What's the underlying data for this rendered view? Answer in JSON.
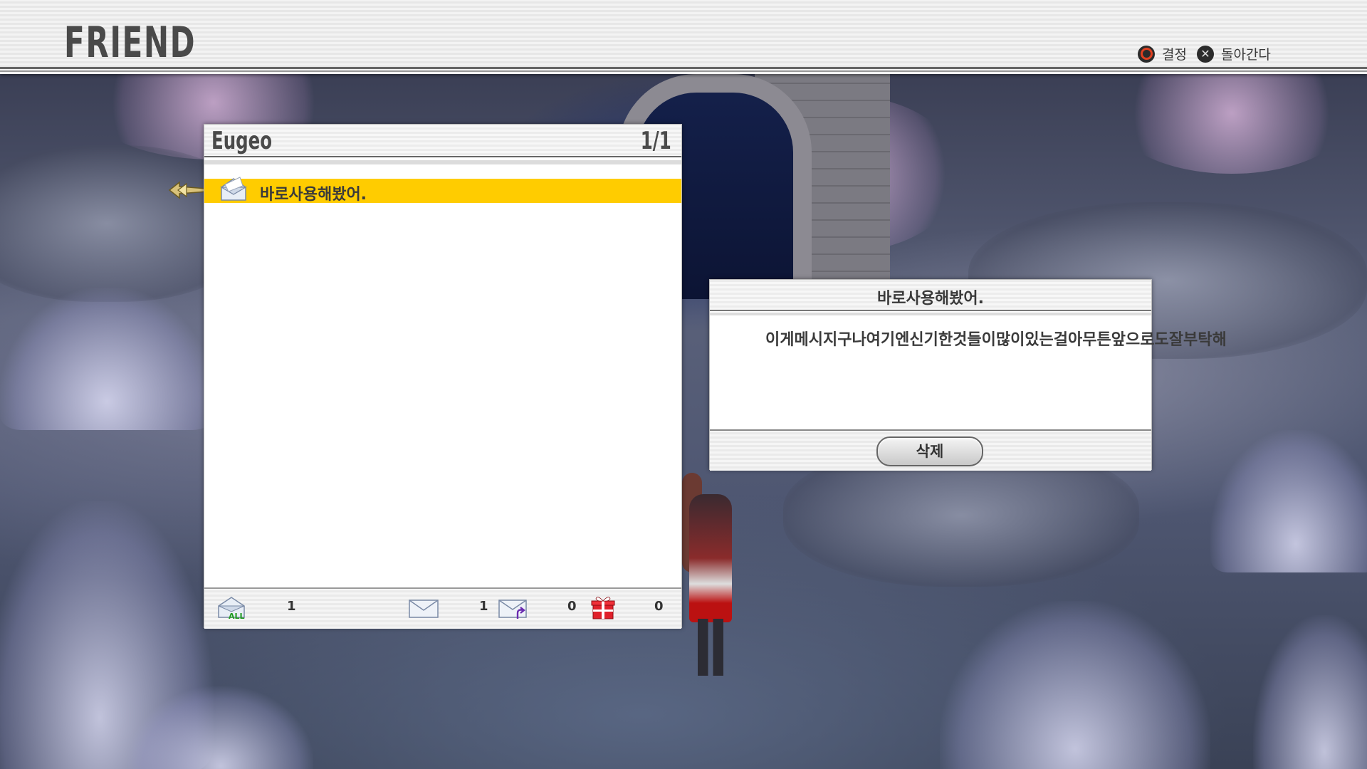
{
  "header": {
    "title": "FRIEND",
    "controls": [
      {
        "icon": "circle-button-icon",
        "label": "결정"
      },
      {
        "icon": "cross-button-icon",
        "label": "돌아간다"
      }
    ]
  },
  "list_panel": {
    "friend_name": "Eugeo",
    "page_indicator": "1/1",
    "messages": [
      {
        "subject": "바로사용해봤어.",
        "icon": "opened-envelope-icon",
        "selected": true
      }
    ],
    "footer": {
      "all_count": "1",
      "unread_count": "1",
      "reply_count": "0",
      "gift_count": "0"
    }
  },
  "detail_panel": {
    "title": "바로사용해봤어.",
    "body": "이게메시지구나여기엔신기한것들이많이있는걸아무튼앞으로도잘부탁해",
    "delete_label": "삭제"
  },
  "colors": {
    "selection": "#ffcc00",
    "header_text": "#4a4a4a"
  }
}
